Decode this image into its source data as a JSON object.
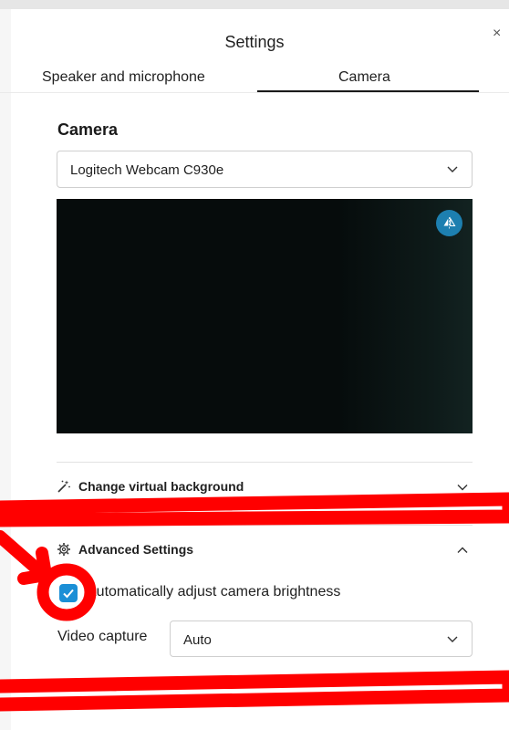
{
  "dialog": {
    "title": "Settings",
    "close_glyph": "×"
  },
  "tabs": [
    {
      "label": "Speaker and microphone",
      "active": false
    },
    {
      "label": "Camera",
      "active": true
    }
  ],
  "camera": {
    "heading": "Camera",
    "device_selected": "Logitech Webcam C930e",
    "preview_mirror_icon": "mirror-icon"
  },
  "virtual_background": {
    "label": "Change virtual background",
    "icon": "magic-wand-icon",
    "expanded": false
  },
  "advanced": {
    "label": "Advanced Settings",
    "icon": "gear-icon",
    "expanded": true,
    "auto_brightness_label": "Automatically adjust camera brightness",
    "auto_brightness_checked": true,
    "video_capture_label": "Video capture",
    "video_capture_value": "Auto"
  },
  "colors": {
    "accent": "#1b8fd6",
    "annotation": "#ff0000"
  }
}
